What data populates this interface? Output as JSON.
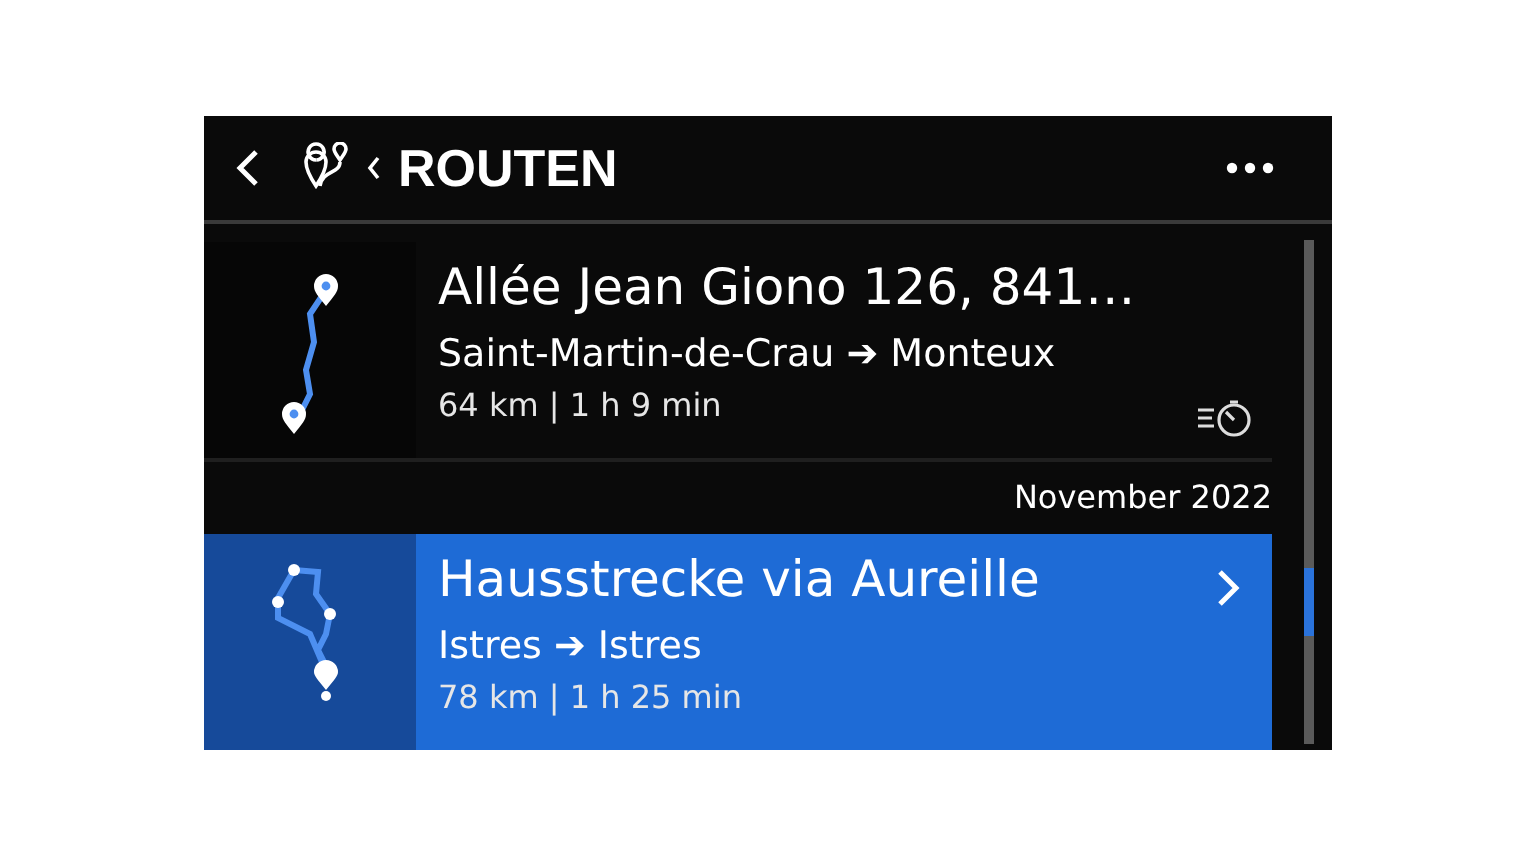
{
  "header": {
    "title": "ROUTEN"
  },
  "items": [
    {
      "kind": "route",
      "title": "Allée Jean Giono 126, 841…",
      "route": "Saint-Martin-de-Crau ➔ Monteux",
      "stats": "64 km | 1 h 9 min",
      "selected": false,
      "timing_icon": true
    },
    {
      "kind": "section",
      "label": "November 2022"
    },
    {
      "kind": "route",
      "title": "Hausstrecke via Aureille",
      "route": "Istres ➔ Istres",
      "stats": "78 km | 1 h 25 min",
      "selected": true,
      "timing_icon": false
    }
  ]
}
